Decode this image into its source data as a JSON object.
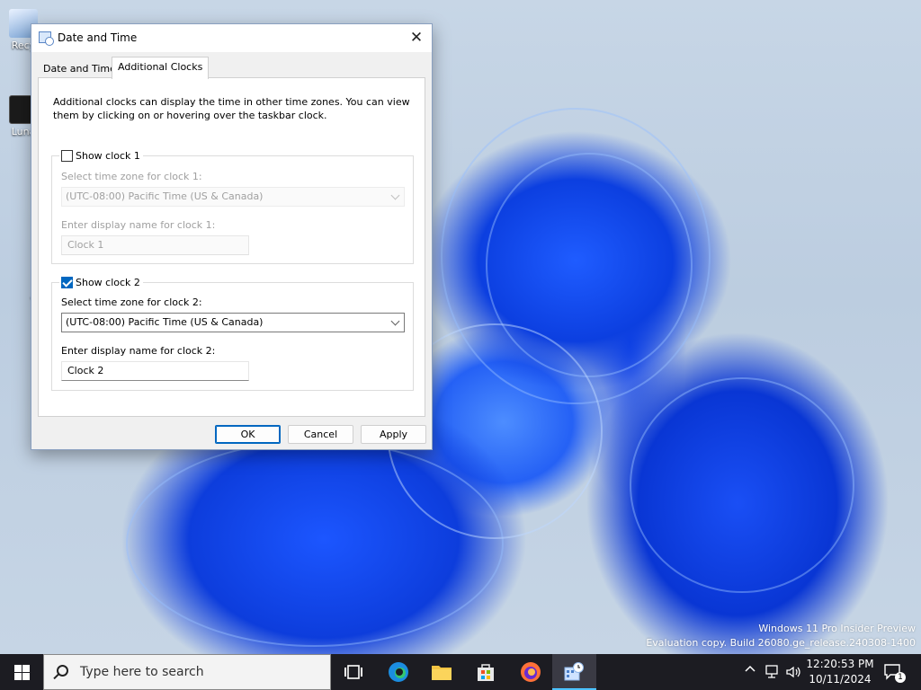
{
  "dialog": {
    "title": "Date and Time",
    "close_glyph": "✕",
    "tabs": [
      {
        "label": "Date and Time",
        "active": false
      },
      {
        "label": "Additional Clocks",
        "active": true
      }
    ],
    "intro": "Additional clocks can display the time in other time zones. You can view them by clicking on or hovering over the taskbar clock.",
    "clock1": {
      "show_label": "Show clock 1",
      "checked": false,
      "timezone_label": "Select time zone for clock 1:",
      "timezone_value": "(UTC-08:00) Pacific Time (US & Canada)",
      "name_label": "Enter display name for clock 1:",
      "name_value": "Clock 1"
    },
    "clock2": {
      "show_label": "Show clock 2",
      "checked": true,
      "timezone_label": "Select time zone for clock 2:",
      "timezone_value": "(UTC-08:00) Pacific Time (US & Canada)",
      "name_label": "Enter display name for clock 2:",
      "name_value": "Clock 2"
    },
    "buttons": {
      "ok": "OK",
      "cancel": "Cancel",
      "apply": "Apply"
    }
  },
  "desktop": {
    "icons": [
      {
        "label": "Recy",
        "icon": "recycle-bin-icon"
      },
      {
        "label": "Luna",
        "icon": "shortcut-icon"
      }
    ],
    "watermark": {
      "line1": "Windows 11 Pro Insider Preview",
      "line2": "Evaluation copy. Build 26080.ge_release.240308-1400"
    }
  },
  "taskbar": {
    "search_placeholder": "Type here to search",
    "apps": [
      "task-view-icon",
      "edge-icon",
      "file-explorer-icon",
      "store-icon",
      "firefox-icon",
      "date-time-settings-icon"
    ],
    "tray": {
      "chevron": "^",
      "time": "12:20:53 PM",
      "date": "10/11/2024",
      "notification_count": "1"
    }
  },
  "colors": {
    "accent": "#0067c0",
    "taskbar": "#1c1c22",
    "dialog_bg": "#f0f0f0"
  }
}
